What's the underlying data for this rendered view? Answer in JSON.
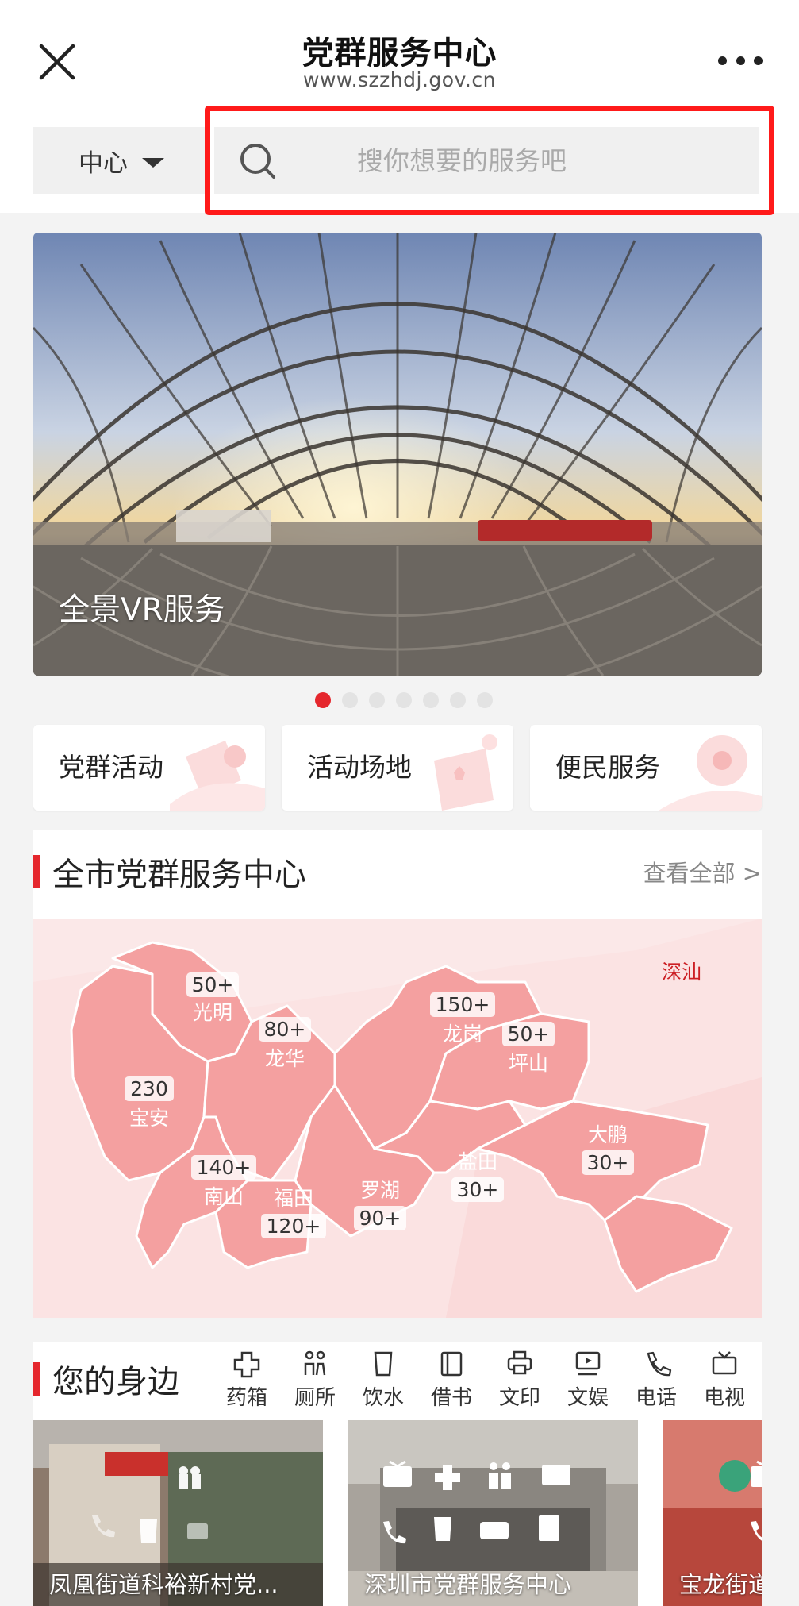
{
  "header": {
    "title": "党群服务中心",
    "subtitle": "www.szzhdj.gov.cn"
  },
  "filter": {
    "label": "中心"
  },
  "search": {
    "placeholder": "搜你想要的服务吧"
  },
  "banner": {
    "caption": "全景VR服务",
    "dot_count": 7,
    "active_dot": 0
  },
  "categories": [
    {
      "label": "党群活动"
    },
    {
      "label": "活动场地"
    },
    {
      "label": "便民服务"
    }
  ],
  "centers": {
    "title": "全市党群服务中心",
    "view_all": "查看全部 >",
    "districts": [
      {
        "name": "光明",
        "count": "50+"
      },
      {
        "name": "龙华",
        "count": "80+"
      },
      {
        "name": "宝安",
        "count": "230"
      },
      {
        "name": "南山",
        "count": "140+"
      },
      {
        "name": "福田",
        "count": "120+"
      },
      {
        "name": "罗湖",
        "count": "90+"
      },
      {
        "name": "龙岗",
        "count": "150+"
      },
      {
        "name": "坪山",
        "count": "50+"
      },
      {
        "name": "盐田",
        "count": "30+"
      },
      {
        "name": "大鹏",
        "count": "30+"
      }
    ],
    "extra_label": "深汕"
  },
  "nearby": {
    "title": "您的身边",
    "amenities": [
      {
        "label": "药箱",
        "icon": "medicine-box-icon"
      },
      {
        "label": "厕所",
        "icon": "toilet-icon"
      },
      {
        "label": "饮水",
        "icon": "water-cup-icon"
      },
      {
        "label": "借书",
        "icon": "book-icon"
      },
      {
        "label": "文印",
        "icon": "printer-icon"
      },
      {
        "label": "文娱",
        "icon": "entertainment-icon"
      },
      {
        "label": "电话",
        "icon": "phone-icon"
      },
      {
        "label": "电视",
        "icon": "tv-icon"
      }
    ],
    "places": [
      {
        "name": "凤凰街道科裕新村党..."
      },
      {
        "name": "深圳市党群服务中心"
      },
      {
        "name": "宝龙街道"
      }
    ]
  },
  "colors": {
    "accent": "#e5272d",
    "map_fill": "#f49a9a",
    "highlight": "#ff1a1a"
  }
}
